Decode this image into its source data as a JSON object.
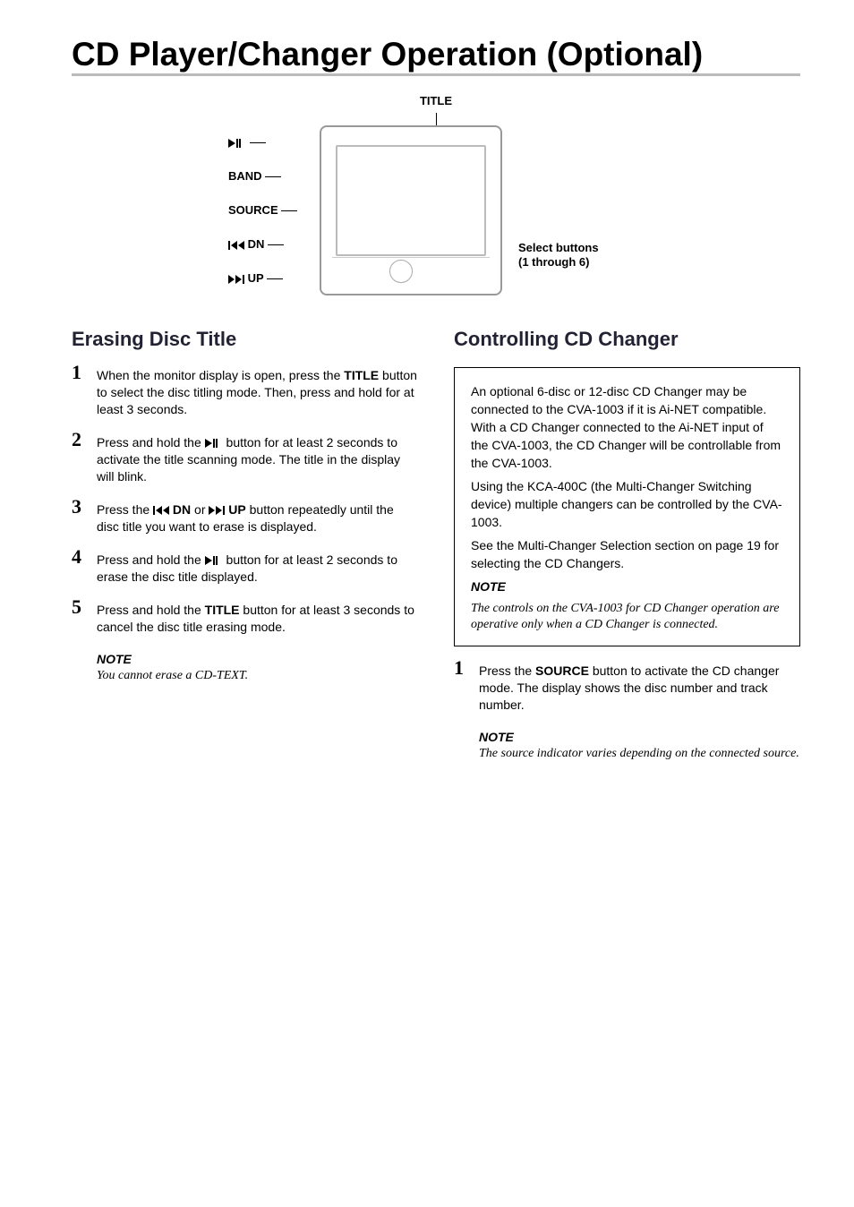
{
  "title": "CD Player/Changer Operation (Optional)",
  "diagram": {
    "topLabel": "TITLE",
    "leftLabels": {
      "playPause": "",
      "band": "BAND",
      "source": "SOURCE",
      "dn": "DN",
      "up": "UP"
    },
    "rightLabel": "Select buttons\n(1 through 6)"
  },
  "left": {
    "heading": "Erasing Disc Title",
    "steps": {
      "s1_a": "When the monitor display is open, press the ",
      "s1_title": "TITLE",
      "s1_b": " button to select the disc titling mode. Then, press and hold for at least 3 seconds.",
      "s2_a": "Press and hold the ",
      "s2_b": " button for at least 2 seconds to activate the title scanning mode. The title in the display will blink.",
      "s3_a": "Press the ",
      "s3_dn": "DN",
      "s3_or": " or ",
      "s3_up": "UP",
      "s3_b": " button repeatedly until the disc title you want to erase is displayed.",
      "s4_a": "Press and hold the ",
      "s4_b": " button for at least 2 seconds to erase the disc title displayed.",
      "s5_a": "Press and hold the ",
      "s5_title": "TITLE",
      "s5_b": " button for at least 3 seconds to cancel the disc title erasing mode."
    },
    "noteLabel": "NOTE",
    "noteText": "You cannot erase a CD-TEXT."
  },
  "right": {
    "heading": "Controlling CD Changer",
    "box": {
      "p1": "An optional 6-disc or 12-disc CD Changer may be connected to the CVA-1003 if it is Ai-NET compatible. With a CD Changer connected to the Ai-NET input of the CVA-1003, the CD Changer will be controllable from the CVA-1003.",
      "p2": "Using the KCA-400C (the Multi-Changer Switching device) multiple changers can be controlled by the CVA-1003.",
      "p3": "See the Multi-Changer Selection section on page 19 for selecting the CD Changers.",
      "noteLabel": "NOTE",
      "noteText": "The controls on the CVA-1003 for CD Changer operation are operative only when a CD Changer is connected."
    },
    "steps": {
      "s1_a": "Press the ",
      "s1_source": "SOURCE",
      "s1_b": " button to activate the CD changer mode. The display shows the disc number and track number."
    },
    "noteLabel": "NOTE",
    "noteText": "The source indicator varies depending on the connected source."
  }
}
